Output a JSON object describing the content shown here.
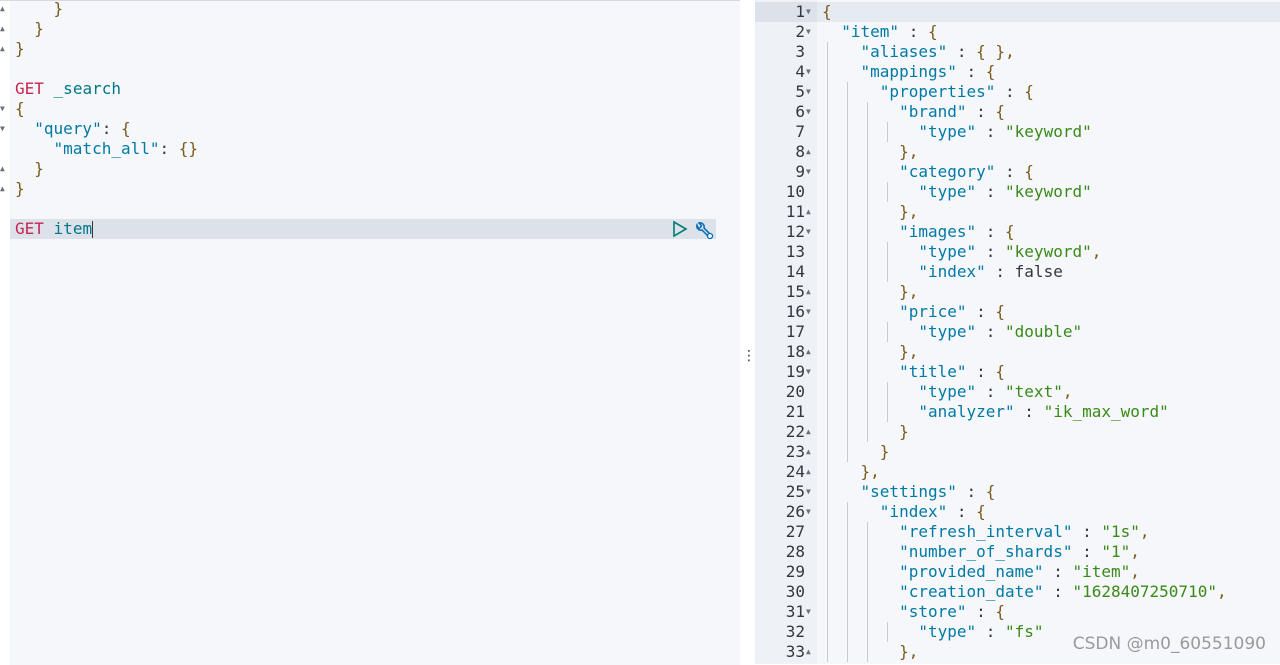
{
  "request_editor": {
    "lines": [
      {
        "text": "    }",
        "fold": "up"
      },
      {
        "text": "  }",
        "fold": "up"
      },
      {
        "text": "}",
        "fold": "up"
      },
      {
        "text": "",
        "fold": ""
      },
      {
        "text": "GET _search",
        "fold": ""
      },
      {
        "text": "{",
        "fold": "down"
      },
      {
        "text": "  \"query\": {",
        "fold": "down"
      },
      {
        "text": "    \"match_all\": {}",
        "fold": ""
      },
      {
        "text": "  }",
        "fold": "up"
      },
      {
        "text": "}",
        "fold": "up"
      },
      {
        "text": "",
        "fold": ""
      },
      {
        "text": "GET item",
        "fold": ""
      }
    ],
    "active_line": 11,
    "run_icon": "play-icon",
    "settings_icon": "wrench-icon"
  },
  "resizer_icon": "vertical-ellipsis-icon",
  "response_viewer": {
    "lines": [
      {
        "n": "1",
        "fold": "down",
        "text": "{"
      },
      {
        "n": "2",
        "fold": "down",
        "text": "  \"item\" : {"
      },
      {
        "n": "3",
        "fold": "",
        "text": "    \"aliases\" : { },"
      },
      {
        "n": "4",
        "fold": "down",
        "text": "    \"mappings\" : {"
      },
      {
        "n": "5",
        "fold": "down",
        "text": "      \"properties\" : {"
      },
      {
        "n": "6",
        "fold": "down",
        "text": "        \"brand\" : {"
      },
      {
        "n": "7",
        "fold": "",
        "text": "          \"type\" : \"keyword\""
      },
      {
        "n": "8",
        "fold": "up",
        "text": "        },"
      },
      {
        "n": "9",
        "fold": "down",
        "text": "        \"category\" : {"
      },
      {
        "n": "10",
        "fold": "",
        "text": "          \"type\" : \"keyword\""
      },
      {
        "n": "11",
        "fold": "up",
        "text": "        },"
      },
      {
        "n": "12",
        "fold": "down",
        "text": "        \"images\" : {"
      },
      {
        "n": "13",
        "fold": "",
        "text": "          \"type\" : \"keyword\","
      },
      {
        "n": "14",
        "fold": "",
        "text": "          \"index\" : false"
      },
      {
        "n": "15",
        "fold": "up",
        "text": "        },"
      },
      {
        "n": "16",
        "fold": "down",
        "text": "        \"price\" : {"
      },
      {
        "n": "17",
        "fold": "",
        "text": "          \"type\" : \"double\""
      },
      {
        "n": "18",
        "fold": "up",
        "text": "        },"
      },
      {
        "n": "19",
        "fold": "down",
        "text": "        \"title\" : {"
      },
      {
        "n": "20",
        "fold": "",
        "text": "          \"type\" : \"text\","
      },
      {
        "n": "21",
        "fold": "",
        "text": "          \"analyzer\" : \"ik_max_word\""
      },
      {
        "n": "22",
        "fold": "up",
        "text": "        }"
      },
      {
        "n": "23",
        "fold": "up",
        "text": "      }"
      },
      {
        "n": "24",
        "fold": "up",
        "text": "    },"
      },
      {
        "n": "25",
        "fold": "down",
        "text": "    \"settings\" : {"
      },
      {
        "n": "26",
        "fold": "down",
        "text": "      \"index\" : {"
      },
      {
        "n": "27",
        "fold": "",
        "text": "        \"refresh_interval\" : \"1s\","
      },
      {
        "n": "28",
        "fold": "",
        "text": "        \"number_of_shards\" : \"1\","
      },
      {
        "n": "29",
        "fold": "",
        "text": "        \"provided_name\" : \"item\","
      },
      {
        "n": "30",
        "fold": "",
        "text": "        \"creation_date\" : \"1628407250710\","
      },
      {
        "n": "31",
        "fold": "down",
        "text": "        \"store\" : {"
      },
      {
        "n": "32",
        "fold": "",
        "text": "          \"type\" : \"fs\""
      },
      {
        "n": "33",
        "fold": "up",
        "text": "        },"
      }
    ]
  },
  "watermark": "CSDN @m0_60551090",
  "colors": {
    "key": "#0079a5",
    "string": "#3a8a1a",
    "boolean": "#5a5ae6",
    "method": "#c7254e",
    "url": "#00778a",
    "active_line": "#dde2ea"
  }
}
